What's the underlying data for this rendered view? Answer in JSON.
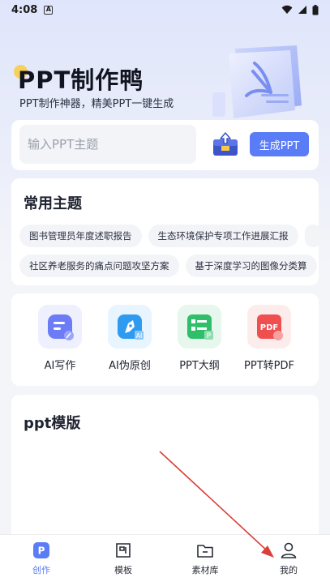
{
  "status_bar": {
    "time": "4:08",
    "notification_badge": "A"
  },
  "header": {
    "title": "PPT制作鸭",
    "subtitle": "PPT制作神器，精美PPT一键生成"
  },
  "input_card": {
    "placeholder": "输入PPT主题",
    "value": "",
    "generate_label": "生成PPT"
  },
  "topics": {
    "heading": "常用主题",
    "row1": [
      "图书管理员年度述职报告",
      "生态环境保护专项工作进展汇报",
      ""
    ],
    "row2": [
      "社区养老服务的痛点问题攻坚方案",
      "基于深度学习的图像分类算"
    ]
  },
  "tools": [
    {
      "label": "AI写作",
      "icon": "ai-writing-icon",
      "color": "#6b7cf6"
    },
    {
      "label": "AI伪原创",
      "icon": "ai-rewrite-icon",
      "color": "#2f9bf0"
    },
    {
      "label": "PPT大纲",
      "icon": "ppt-outline-icon",
      "color": "#2fbe6a"
    },
    {
      "label": "PPT转PDF",
      "icon": "ppt-to-pdf-icon",
      "color": "#f04f50"
    }
  ],
  "template_section": {
    "heading": "ppt模版"
  },
  "bottom_nav": [
    {
      "label": "创作",
      "icon": "create-icon",
      "active": true
    },
    {
      "label": "模板",
      "icon": "template-icon",
      "active": false
    },
    {
      "label": "素材库",
      "icon": "material-folder-icon",
      "active": false
    },
    {
      "label": "我的",
      "icon": "profile-icon",
      "active": false
    }
  ],
  "colors": {
    "accent": "#5b7cf7",
    "arrow": "#d9403a"
  }
}
